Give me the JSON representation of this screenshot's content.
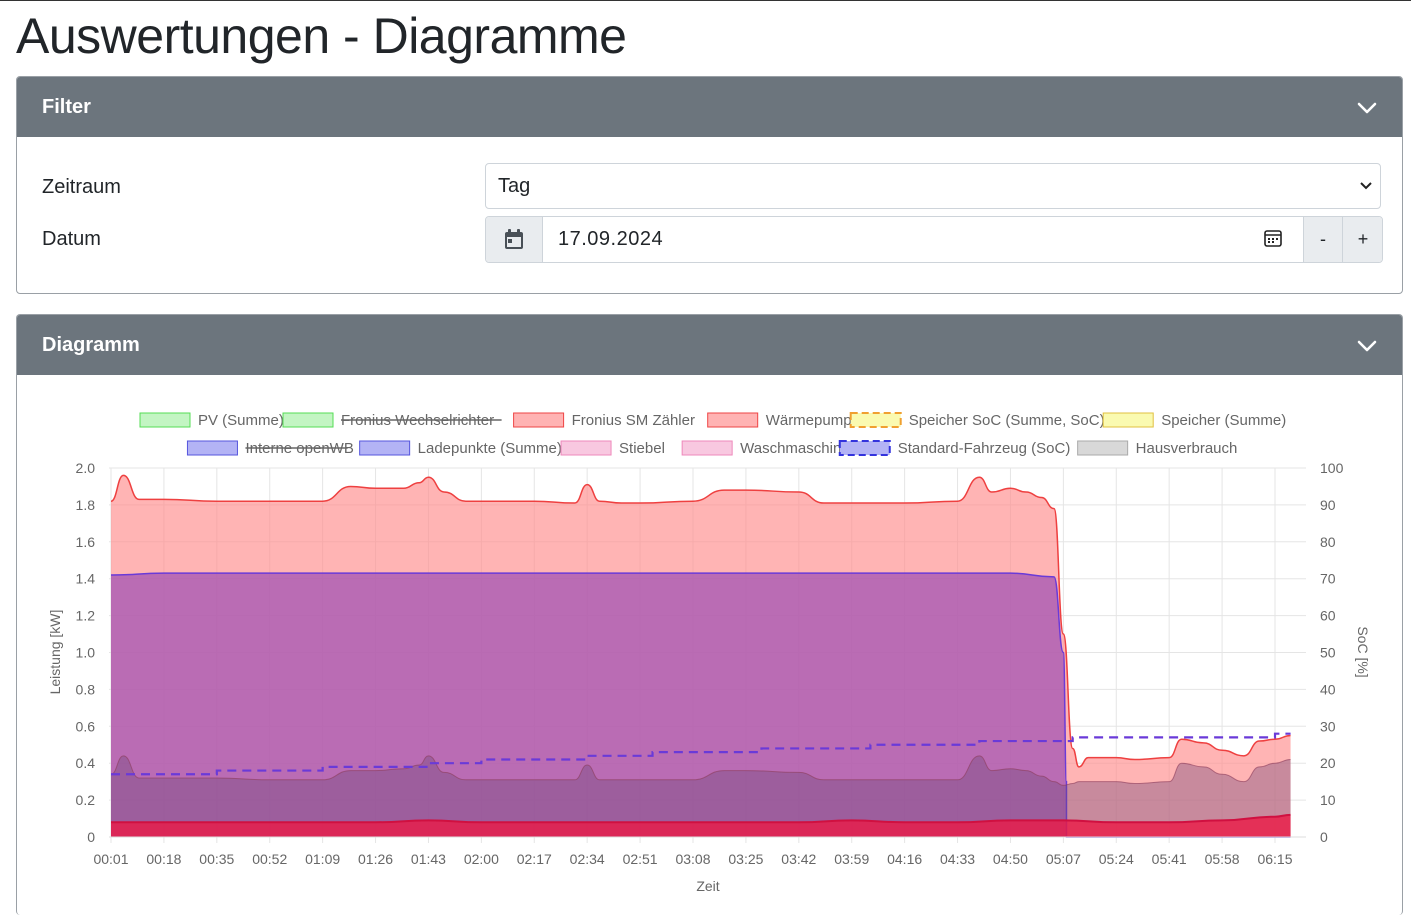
{
  "page": {
    "title": "Auswertungen - Diagramme"
  },
  "filter": {
    "header": "Filter",
    "zeitraum_label": "Zeitraum",
    "zeitraum_value": "Tag",
    "datum_label": "Datum",
    "datum_value": "17.09.2024",
    "minus_label": "-",
    "plus_label": "+"
  },
  "diagram": {
    "header": "Diagramm"
  },
  "chart_data": {
    "type": "area",
    "xlabel": "Zeit",
    "ylabel": "Leistung [kW]",
    "y2label": "SoC [%]",
    "ylim": [
      0,
      2.0
    ],
    "y2lim": [
      0,
      100
    ],
    "yticks": [
      "2.0",
      "1.8",
      "1.6",
      "1.4",
      "1.2",
      "1.0",
      "0.8",
      "0.6",
      "0.4",
      "0.2",
      "0"
    ],
    "y2ticks": [
      "100",
      "90",
      "80",
      "70",
      "60",
      "50",
      "40",
      "30",
      "20",
      "10",
      "0"
    ],
    "xticks": [
      "00:01",
      "00:18",
      "00:35",
      "00:52",
      "01:09",
      "01:26",
      "01:43",
      "02:00",
      "02:17",
      "02:34",
      "02:51",
      "03:08",
      "03:25",
      "03:42",
      "03:59",
      "04:16",
      "04:33",
      "04:50",
      "05:07",
      "05:24",
      "05:41",
      "05:58",
      "06:15"
    ],
    "grid": true,
    "legend": [
      {
        "label": "PV (Summe)",
        "fill": "#c3f5c3",
        "stroke": "#55dd55",
        "dash": false,
        "hidden": false
      },
      {
        "label": "Fronius Wechselrichter",
        "fill": "#c3f5c3",
        "stroke": "#55dd55",
        "dash": false,
        "hidden": true
      },
      {
        "label": "Fronius SM Zähler",
        "fill": "#ffb3b3",
        "stroke": "#ee4444",
        "dash": false,
        "hidden": false
      },
      {
        "label": "Wärmepumpe",
        "fill": "#ffb3b3",
        "stroke": "#ee4444",
        "dash": false,
        "hidden": false
      },
      {
        "label": "Speicher SoC (Summe, SoC)",
        "fill": "#fafab0",
        "stroke": "#f0a030",
        "dash": true,
        "hidden": false
      },
      {
        "label": "Speicher (Summe)",
        "fill": "#fafab0",
        "stroke": "#e0c040",
        "dash": false,
        "hidden": false
      },
      {
        "label": "Interne openWB",
        "fill": "#b3b3f5",
        "stroke": "#5555dd",
        "dash": false,
        "hidden": true
      },
      {
        "label": "Ladepunkte (Summe)",
        "fill": "#b3b3f5",
        "stroke": "#5555dd",
        "dash": false,
        "hidden": false
      },
      {
        "label": "Stiebel",
        "fill": "#f8c8e0",
        "stroke": "#ee88bb",
        "dash": false,
        "hidden": false
      },
      {
        "label": "Waschmaschin",
        "fill": "#f8c8e0",
        "stroke": "#ee88bb",
        "dash": false,
        "hidden": false
      },
      {
        "label": "Standard-Fahrzeug (SoC)",
        "fill": "#b3b3f5",
        "stroke": "#3333dd",
        "dash": true,
        "hidden": false
      },
      {
        "label": "Hausverbrauch",
        "fill": "#d8d8d8",
        "stroke": "#aaaaaa",
        "dash": false,
        "hidden": false
      }
    ],
    "series": [
      {
        "name": "Fronius SM Zähler",
        "x": [
          "00:01",
          "00:05",
          "00:10",
          "00:18",
          "00:35",
          "00:52",
          "01:09",
          "01:18",
          "01:26",
          "01:35",
          "01:40",
          "01:43",
          "01:48",
          "01:55",
          "02:00",
          "02:17",
          "02:30",
          "02:34",
          "02:38",
          "02:45",
          "02:51",
          "03:08",
          "03:18",
          "03:25",
          "03:42",
          "03:50",
          "03:59",
          "04:16",
          "04:33",
          "04:40",
          "04:44",
          "04:50",
          "04:55",
          "05:00",
          "05:04",
          "05:07",
          "05:10",
          "05:12",
          "05:15",
          "05:24",
          "05:30",
          "05:41",
          "05:45",
          "05:52",
          "05:58",
          "06:05",
          "06:10",
          "06:15",
          "06:20"
        ],
        "values": [
          1.82,
          1.96,
          1.83,
          1.83,
          1.82,
          1.82,
          1.82,
          1.9,
          1.89,
          1.89,
          1.92,
          1.95,
          1.87,
          1.82,
          1.82,
          1.82,
          1.81,
          1.91,
          1.82,
          1.81,
          1.81,
          1.82,
          1.88,
          1.88,
          1.87,
          1.81,
          1.81,
          1.81,
          1.82,
          1.95,
          1.87,
          1.89,
          1.87,
          1.84,
          1.78,
          1.1,
          0.48,
          0.38,
          0.43,
          0.43,
          0.42,
          0.43,
          0.53,
          0.51,
          0.47,
          0.44,
          0.52,
          0.53,
          0.55
        ]
      },
      {
        "name": "Ladepunkte (Summe)",
        "x": [
          "00:01",
          "00:18",
          "00:35",
          "00:52",
          "01:09",
          "01:26",
          "01:43",
          "02:00",
          "02:17",
          "02:34",
          "02:51",
          "03:08",
          "03:25",
          "03:42",
          "03:59",
          "04:16",
          "04:33",
          "04:50",
          "05:04",
          "05:07",
          "05:08",
          "05:08",
          "06:20"
        ],
        "values": [
          1.42,
          1.43,
          1.43,
          1.43,
          1.43,
          1.43,
          1.43,
          1.43,
          1.43,
          1.43,
          1.43,
          1.43,
          1.43,
          1.43,
          1.43,
          1.43,
          1.43,
          1.43,
          1.41,
          1.0,
          0.3,
          0,
          0
        ]
      },
      {
        "name": "Hausverbrauch",
        "x": [
          "00:01",
          "00:05",
          "00:10",
          "00:18",
          "00:35",
          "00:52",
          "01:09",
          "01:18",
          "01:26",
          "01:35",
          "01:40",
          "01:43",
          "01:48",
          "01:55",
          "02:00",
          "02:17",
          "02:30",
          "02:34",
          "02:38",
          "02:45",
          "02:51",
          "03:08",
          "03:18",
          "03:25",
          "03:42",
          "03:50",
          "03:59",
          "04:16",
          "04:33",
          "04:40",
          "04:44",
          "04:50",
          "04:55",
          "05:00",
          "05:04",
          "05:07",
          "05:10",
          "05:12",
          "05:15",
          "05:24",
          "05:30",
          "05:41",
          "05:45",
          "05:52",
          "05:58",
          "06:05",
          "06:10",
          "06:15",
          "06:20"
        ],
        "values": [
          0.34,
          0.44,
          0.32,
          0.32,
          0.32,
          0.31,
          0.31,
          0.36,
          0.36,
          0.37,
          0.39,
          0.44,
          0.35,
          0.31,
          0.31,
          0.31,
          0.31,
          0.39,
          0.31,
          0.31,
          0.31,
          0.31,
          0.36,
          0.36,
          0.35,
          0.31,
          0.31,
          0.31,
          0.31,
          0.44,
          0.36,
          0.37,
          0.36,
          0.33,
          0.3,
          0.28,
          0.29,
          0.3,
          0.3,
          0.3,
          0.29,
          0.3,
          0.4,
          0.38,
          0.34,
          0.3,
          0.38,
          0.4,
          0.42
        ]
      },
      {
        "name": "Wärmepumpe",
        "x": [
          "00:01",
          "00:10",
          "00:35",
          "01:00",
          "01:26",
          "01:43",
          "02:00",
          "02:17",
          "02:34",
          "02:51",
          "03:08",
          "03:25",
          "03:42",
          "03:59",
          "04:16",
          "04:33",
          "04:50",
          "05:07",
          "05:24",
          "05:41",
          "05:58",
          "06:15",
          "06:20"
        ],
        "values": [
          0.08,
          0.08,
          0.08,
          0.08,
          0.08,
          0.09,
          0.08,
          0.08,
          0.08,
          0.08,
          0.08,
          0.08,
          0.08,
          0.09,
          0.08,
          0.08,
          0.09,
          0.09,
          0.08,
          0.08,
          0.09,
          0.11,
          0.12
        ]
      },
      {
        "name": "Standard-Fahrzeug (SoC)",
        "x": [
          "00:01",
          "00:10",
          "00:18",
          "00:35",
          "00:52",
          "00:55",
          "01:09",
          "01:26",
          "01:30",
          "01:43",
          "01:55",
          "02:00",
          "02:17",
          "02:25",
          "02:34",
          "02:51",
          "02:55",
          "03:08",
          "03:25",
          "03:30",
          "03:42",
          "03:59",
          "04:05",
          "04:16",
          "04:33",
          "04:40",
          "04:50",
          "05:07",
          "05:10",
          "05:24",
          "05:41",
          "05:58",
          "06:10",
          "06:15",
          "06:20"
        ],
        "values": [
          17,
          17,
          17,
          18,
          18,
          18,
          19,
          19,
          19,
          20,
          20,
          21,
          21,
          21,
          22,
          22,
          23,
          23,
          23,
          24,
          24,
          24,
          25,
          25,
          25,
          26,
          26,
          26,
          27,
          27,
          27,
          27,
          27,
          28,
          28
        ]
      }
    ]
  }
}
